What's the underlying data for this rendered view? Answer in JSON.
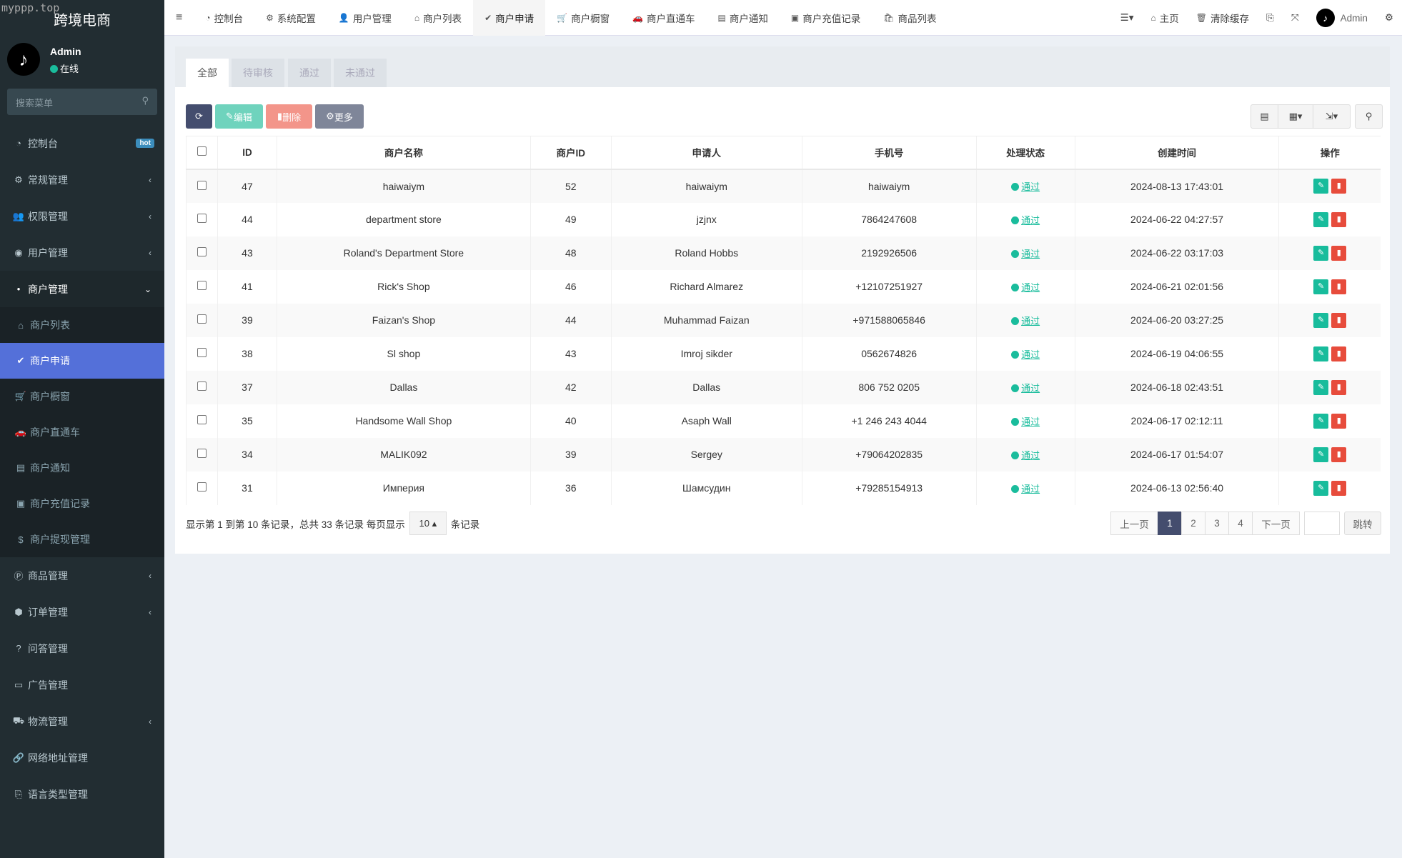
{
  "app": {
    "title": "跨境电商",
    "watermark": "myppp.top"
  },
  "user": {
    "name": "Admin",
    "status": "在线"
  },
  "search": {
    "placeholder": "搜索菜单"
  },
  "sidebar": {
    "items": [
      {
        "label": "控制台",
        "icon": "dashboard-icon",
        "badge": "hot"
      },
      {
        "label": "常规管理",
        "icon": "cogs-icon"
      },
      {
        "label": "权限管理",
        "icon": "group-icon"
      },
      {
        "label": "用户管理",
        "icon": "user-circle-icon"
      },
      {
        "label": "商户管理",
        "icon": "apple-icon"
      },
      {
        "label": "商品管理",
        "icon": "product-icon"
      },
      {
        "label": "订单管理",
        "icon": "cube-icon"
      },
      {
        "label": "问答管理",
        "icon": "question-icon"
      },
      {
        "label": "广告管理",
        "icon": "ad-icon"
      },
      {
        "label": "物流管理",
        "icon": "truck-icon"
      },
      {
        "label": "网络地址管理",
        "icon": "link-icon"
      },
      {
        "label": "语言类型管理",
        "icon": "language-icon"
      }
    ],
    "subitems": [
      {
        "label": "商户列表",
        "icon": "home-icon"
      },
      {
        "label": "商户申请",
        "icon": "check-circle-icon"
      },
      {
        "label": "商户橱窗",
        "icon": "cart-icon"
      },
      {
        "label": "商户直通车",
        "icon": "car-icon"
      },
      {
        "label": "商户通知",
        "icon": "notice-icon"
      },
      {
        "label": "商户充值记录",
        "icon": "money-icon"
      },
      {
        "label": "商户提现管理",
        "icon": "dollar-icon"
      }
    ]
  },
  "topnav": {
    "items": [
      "控制台",
      "系统配置",
      "用户管理",
      "商户列表",
      "商户申请",
      "商户橱窗",
      "商户直通车",
      "商户通知",
      "商户充值记录",
      "商品列表"
    ],
    "home": "主页",
    "clear_cache": "清除缓存",
    "admin": "Admin"
  },
  "tabs": [
    "全部",
    "待审核",
    "通过",
    "未通过"
  ],
  "toolbar": {
    "edit": "编辑",
    "delete": "删除",
    "more": "更多"
  },
  "table": {
    "headers": [
      "ID",
      "商户名称",
      "商户ID",
      "申请人",
      "手机号",
      "处理状态",
      "创建时间",
      "操作"
    ],
    "rows": [
      [
        "47",
        "haiwaiym",
        "52",
        "haiwaiym",
        "haiwaiym",
        "通过",
        "2024-08-13 17:43:01"
      ],
      [
        "44",
        "department store",
        "49",
        "jzjnx",
        "7864247608",
        "通过",
        "2024-06-22 04:27:57"
      ],
      [
        "43",
        "Roland's Department Store",
        "48",
        "Roland Hobbs",
        "2192926506",
        "通过",
        "2024-06-22 03:17:03"
      ],
      [
        "41",
        "Rick's Shop",
        "46",
        "Richard Almarez",
        "+12107251927",
        "通过",
        "2024-06-21 02:01:56"
      ],
      [
        "39",
        "Faizan's Shop",
        "44",
        "Muhammad Faizan",
        "+971588065846",
        "通过",
        "2024-06-20 03:27:25"
      ],
      [
        "38",
        "Sl shop",
        "43",
        "Imroj sikder",
        "0562674826",
        "通过",
        "2024-06-19 04:06:55"
      ],
      [
        "37",
        "Dallas",
        "42",
        "Dallas",
        "806 752 0205",
        "通过",
        "2024-06-18 02:43:51"
      ],
      [
        "35",
        "Handsome Wall Shop",
        "40",
        "Asaph Wall",
        "+1 246 243 4044",
        "通过",
        "2024-06-17 02:12:11"
      ],
      [
        "34",
        "MALIK092",
        "39",
        "Sergey",
        "+79064202835",
        "通过",
        "2024-06-17 01:54:07"
      ],
      [
        "31",
        "Империя",
        "36",
        "Шамсудин",
        "+79285154913",
        "通过",
        "2024-06-13 02:56:40"
      ]
    ]
  },
  "pagination": {
    "info": "显示第 1 到第 10 条记录，总共 33 条记录 每页显示",
    "page_size": "10",
    "suffix": "条记录",
    "prev": "上一页",
    "pages": [
      "1",
      "2",
      "3",
      "4"
    ],
    "next": "下一页",
    "jump": "跳转"
  },
  "colors": {
    "sidebar": "#222d32",
    "active": "#5470d9",
    "success": "#18bc9c",
    "danger": "#e74c3c",
    "primary_dark": "#444d6e"
  }
}
